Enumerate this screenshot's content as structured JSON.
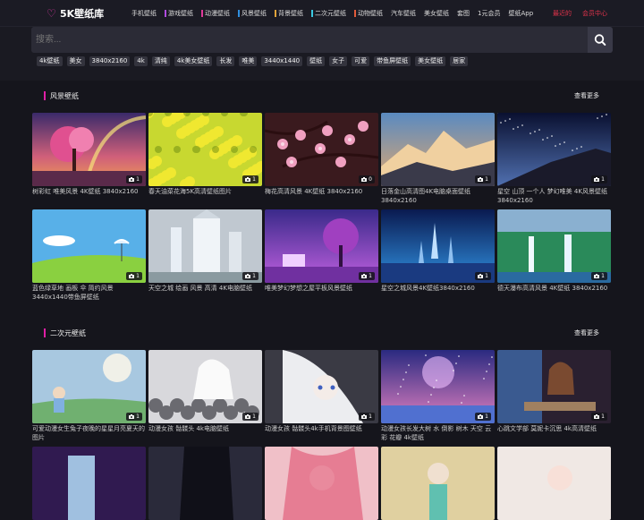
{
  "header": {
    "logo": "5K壁纸库",
    "nav": [
      {
        "label": "手机壁纸",
        "color": ""
      },
      {
        "label": "游戏壁纸",
        "color": "#b04be0"
      },
      {
        "label": "动漫壁纸",
        "color": "#e03a9a"
      },
      {
        "label": "风景壁纸",
        "color": "#2f8fe0"
      },
      {
        "label": "背景壁纸",
        "color": "#e0a33a"
      },
      {
        "label": "二次元壁纸",
        "color": "#3ac9e0"
      },
      {
        "label": "动物壁纸",
        "color": "#e05a3a"
      },
      {
        "label": "汽车壁纸",
        "color": ""
      },
      {
        "label": "美女壁纸",
        "color": ""
      },
      {
        "label": "套图",
        "color": ""
      },
      {
        "label": "1元会员",
        "color": ""
      },
      {
        "label": "壁纸App",
        "color": ""
      }
    ],
    "recent": "最近的",
    "member": "会员中心"
  },
  "search": {
    "placeholder": "搜索..."
  },
  "tags": [
    "4k壁纸",
    "美女",
    "3840x2160",
    "4k",
    "清纯",
    "4k美女壁纸",
    "长发",
    "唯美",
    "3440x1440",
    "壁纸",
    "女子",
    "可爱",
    "带鱼屏壁纸",
    "美女壁纸",
    "居家"
  ],
  "sections": [
    {
      "title": "风景壁纸",
      "more": "查看更多",
      "items": [
        {
          "caption": "树彩虹 唯美风景 4K壁纸 3840x2160",
          "count": "1"
        },
        {
          "caption": "春天油菜花海5K高清壁纸图片",
          "count": "1"
        },
        {
          "caption": "梅花高清风景 4K壁纸 3840x2160",
          "count": "0"
        },
        {
          "caption": "日落金山高清图4K电脑桌面壁纸3840x2160",
          "count": "1"
        },
        {
          "caption": "星空 山顶 一个人 梦幻唯美 4K风景壁纸3840x2160",
          "count": "1"
        },
        {
          "caption": "蓝色绿草地 画板 伞 简约风景3440x1440带鱼屏壁纸",
          "count": "1"
        },
        {
          "caption": "天空之城 绘画 风景 高清 4K电脑壁纸",
          "count": "1"
        },
        {
          "caption": "唯美梦幻梦想之屋平板风景壁纸",
          "count": "1"
        },
        {
          "caption": "星空之城风景4K壁纸3840x2160",
          "count": "1"
        },
        {
          "caption": "德天瀑布高清风景 4K壁纸 3840x2160",
          "count": "1"
        }
      ]
    },
    {
      "title": "二次元壁纸",
      "more": "查看更多",
      "items": [
        {
          "caption": "可爱动漫女生兔子夜晚的星星月亮夏天的图片",
          "count": "1"
        },
        {
          "caption": "动漫女孩 骷髅头 4k电脑壁纸",
          "count": "1"
        },
        {
          "caption": "动漫女孩 骷髅头4k手机背景图壁纸",
          "count": "1"
        },
        {
          "caption": "动漫女孩长发大树 水 倒影 树木 天空 云彩 花瓣 4k壁纸",
          "count": "1"
        },
        {
          "caption": "心跳文学部 莫妮卡沉思 4k高清壁纸",
          "count": "1"
        },
        {
          "caption": "",
          "count": ""
        },
        {
          "caption": "",
          "count": ""
        },
        {
          "caption": "",
          "count": ""
        },
        {
          "caption": "",
          "count": ""
        },
        {
          "caption": "",
          "count": ""
        }
      ]
    }
  ]
}
